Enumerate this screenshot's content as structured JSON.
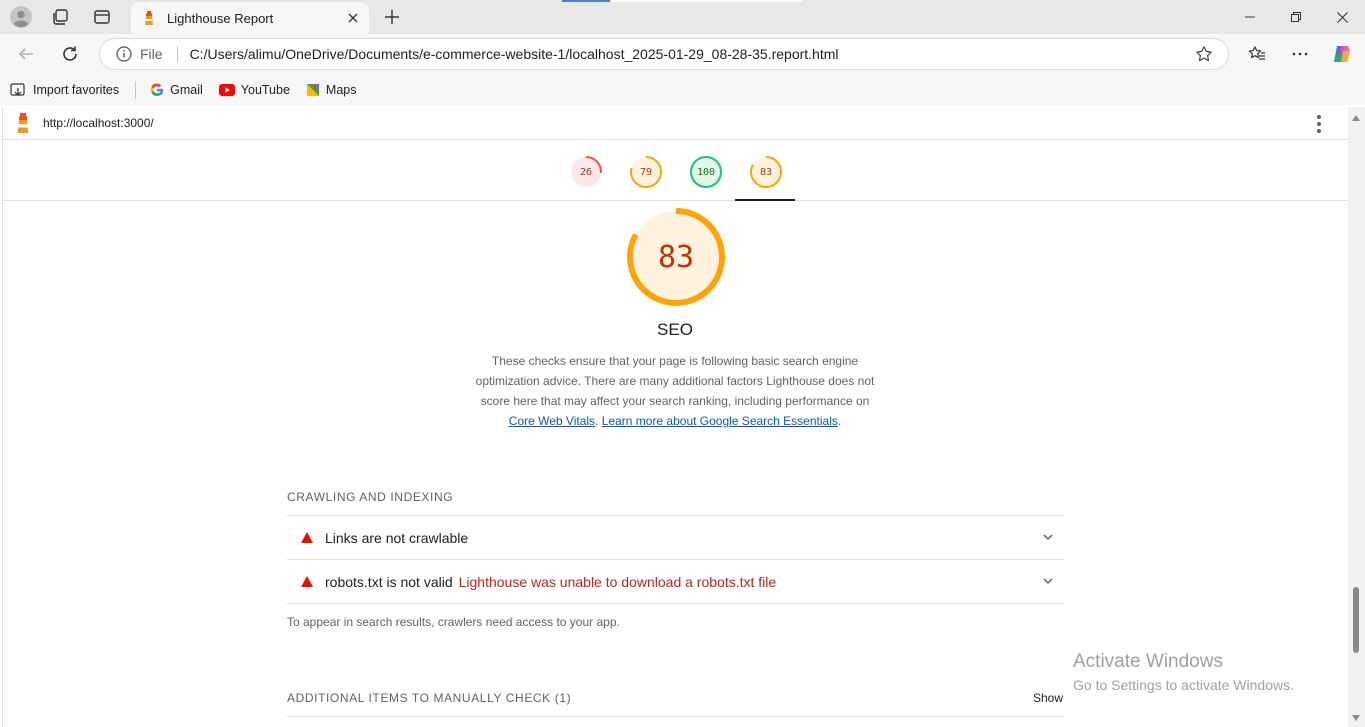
{
  "browser": {
    "tab_title": "Lighthouse Report",
    "address_prefix": "File",
    "url": "C:/Users/alimu/OneDrive/Documents/e-commerce-website-1/localhost_2025-01-29_08-28-35.report.html",
    "favorites": [
      {
        "label": "Import favorites",
        "icon": "import-icon"
      },
      {
        "label": "Gmail",
        "icon": "google-icon"
      },
      {
        "label": "YouTube",
        "icon": "youtube-icon"
      },
      {
        "label": "Maps",
        "icon": "maps-icon"
      }
    ]
  },
  "report": {
    "tested_url": "http://localhost:3000/",
    "scores": [
      {
        "value": "26",
        "score": 0.26,
        "color": "#ff4e42",
        "bg": "#fce8e6"
      },
      {
        "value": "79",
        "score": 0.79,
        "color": "#ffa400",
        "bg": "#fff3e0"
      },
      {
        "value": "100",
        "score": 1.0,
        "color": "#0cce6b",
        "bg": "#e6f4ea"
      },
      {
        "value": "83",
        "score": 0.83,
        "color": "#ffa400",
        "bg": "#fff3e0"
      }
    ],
    "category": {
      "score": "83",
      "score_fraction": 0.83,
      "title": "SEO",
      "description_part1": "These checks ensure that your page is following basic search engine optimization advice. There are many additional factors Lighthouse does not score here that may affect your search ranking, including performance on ",
      "link1": "Core Web Vitals",
      "description_sep": ". ",
      "link2": "Learn more about Google Search Essentials",
      "description_end": "."
    },
    "groups": {
      "crawling": {
        "title": "CRAWLING AND INDEXING",
        "audits": [
          {
            "title": "Links are not crawlable",
            "display": ""
          },
          {
            "title": "robots.txt is not valid",
            "display": "Lighthouse was unable to download a robots.txt file"
          }
        ],
        "description": "To appear in search results, crawlers need access to your app."
      },
      "manual": {
        "title": "ADDITIONAL ITEMS TO MANUALLY CHECK (1)",
        "show_label": "Show"
      }
    }
  },
  "watermark": {
    "line1": "Activate Windows",
    "line2": "Go to Settings to activate Windows."
  },
  "colors": {
    "fail_red": "#eb0f00",
    "average_orange": "#ffa400",
    "pass_green": "#0cce6b",
    "link_blue": "#0b57d0"
  }
}
